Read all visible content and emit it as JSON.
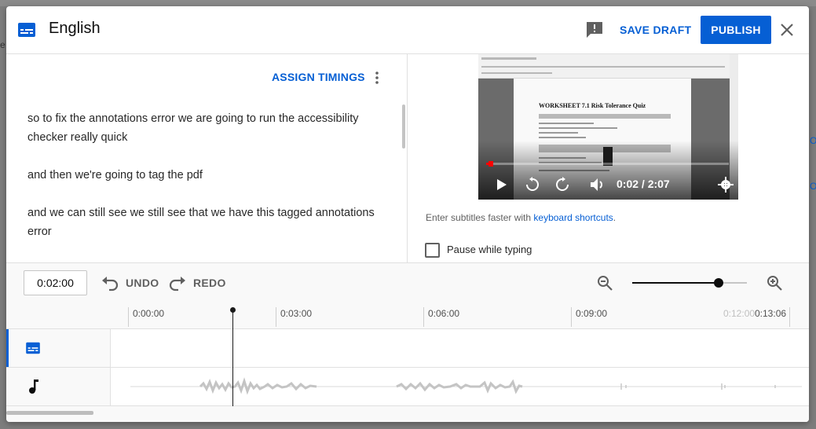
{
  "header": {
    "title": "English",
    "save_draft": "SAVE DRAFT",
    "publish": "PUBLISH"
  },
  "editor": {
    "assign_timings": "ASSIGN TIMINGS",
    "cues": [
      "so to fix the annotations error we are going to run the accessibility checker really quick",
      "and then we're going to tag the pdf",
      "and we can still see we still see that we have this tagged annotations error"
    ]
  },
  "video": {
    "time_display": "0:02 / 2:07",
    "progress_fraction": 0.016,
    "document_heading": "WORKSHEET 7.1 Risk Tolerance Quiz"
  },
  "subtitle_hint": {
    "text": "Enter subtitles faster with ",
    "link": "keyboard shortcuts",
    "suffix": "."
  },
  "pause_while_typing": {
    "label": "Pause while typing",
    "checked": false
  },
  "timeline": {
    "current_time": "0:02:00",
    "undo": "UNDO",
    "redo": "REDO",
    "zoom_level": 0.75,
    "ruler_labels": [
      "0:00:00",
      "0:03:00",
      "0:06:00",
      "0:09:00",
      "0:12:00",
      "0:13:06"
    ]
  },
  "icons": {
    "subtitles": "subtitles-icon",
    "feedback": "feedback-icon",
    "close": "close-icon",
    "more": "more-vert-icon",
    "undo": "undo-icon",
    "redo": "redo-icon",
    "zoom_out": "zoom-out-icon",
    "zoom_in": "zoom-in-icon",
    "audio": "music-note-icon"
  },
  "colors": {
    "accent": "#065fd4",
    "progress": "#ff0000",
    "text": "#0d0d0d"
  }
}
